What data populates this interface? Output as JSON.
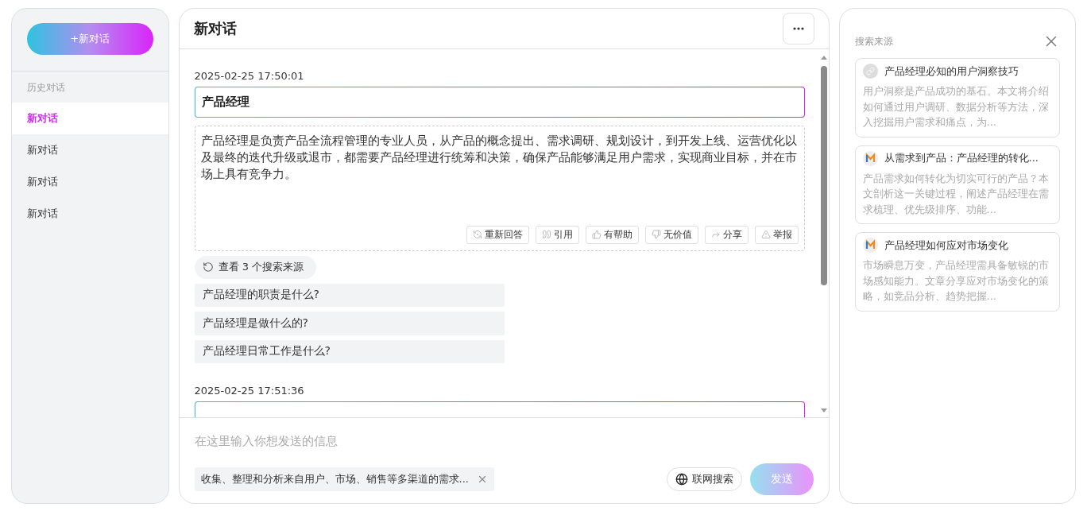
{
  "sidebar": {
    "new_chat_button": "+新对话",
    "history_label": "历史对话",
    "items": [
      {
        "label": "新对话",
        "selected": true
      },
      {
        "label": "新对话",
        "selected": false
      },
      {
        "label": "新对话",
        "selected": false
      },
      {
        "label": "新对话",
        "selected": false
      }
    ]
  },
  "chat": {
    "title": "新对话",
    "messages": [
      {
        "time": "2025-02-25 17:50:01",
        "question": "产品经理",
        "answer": "产品经理是负责产品全流程管理的专业人员，从产品的概念提出、需求调研、规划设计，到开发上线、运营优化以及最终的迭代升级或退市，都需要产品经理进行统筹和决策，确保产品能够满足用户需求，实现商业目标，并在市场上具有竞争力。",
        "actions": [
          "重新回答",
          "引用",
          "有帮助",
          "无价值",
          "分享",
          "举报"
        ],
        "sources_link": "查看 3 个搜索来源",
        "suggestions": [
          "产品经理的职责是什么?",
          "产品经理是做什么的?",
          "产品经理日常工作是什么?"
        ]
      },
      {
        "time": "2025-02-25 17:51:36"
      }
    ],
    "input": {
      "placeholder": "在这里输入你想发送的信息",
      "quote_chip": "收集、整理和分析来自用户、市场、销售等多渠道的需求...",
      "web_search_button": "联网搜索",
      "send_button": "发送",
      "send_disabled": true
    }
  },
  "sources_panel": {
    "title": "搜索来源",
    "items": [
      {
        "kind": "link",
        "title": "产品经理必知的用户洞察技巧",
        "summary": "用户洞察是产品成功的基石。本文将介绍如何通过用户调研、数据分析等方法，深入挖掘用户需求和痛点，为..."
      },
      {
        "kind": "site",
        "title": "从需求到产品：产品经理的转化...",
        "summary": "产品需求如何转化为切实可行的产品？本文剖析这一关键过程，阐述产品经理在需求梳理、优先级排序、功能..."
      },
      {
        "kind": "site",
        "title": "产品经理如何应对市场变化",
        "summary": "市场瞬息万变，产品经理需具备敏锐的市场感知能力。文章分享应对市场变化的策略，如竞品分析、趋势把握..."
      }
    ]
  }
}
